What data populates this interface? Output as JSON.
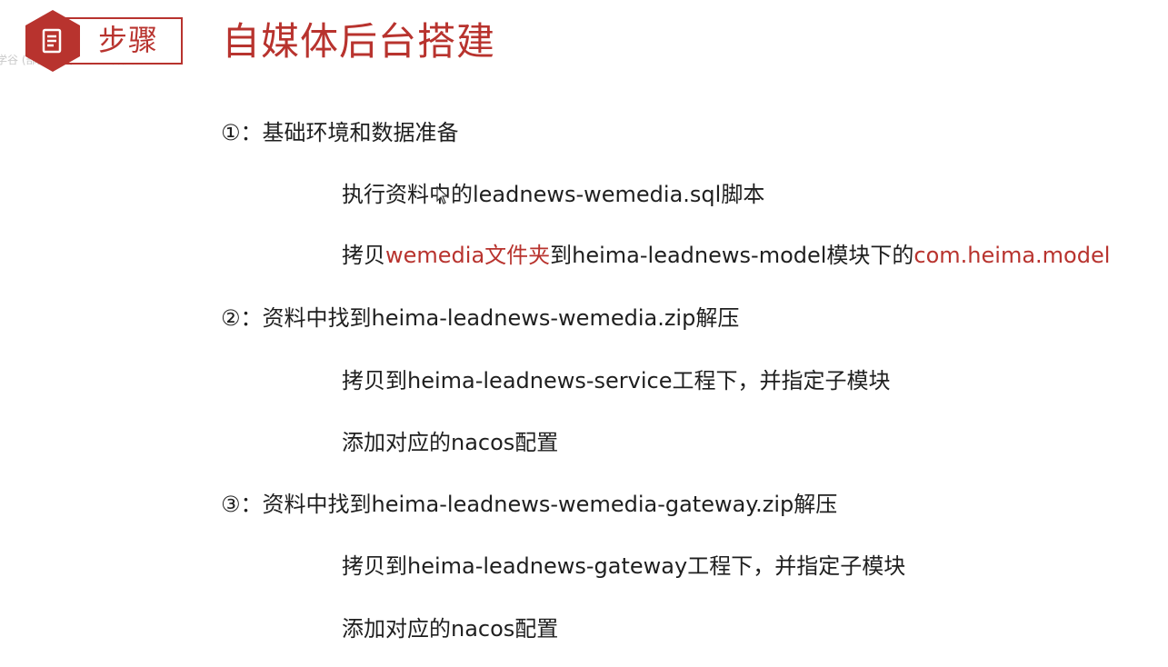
{
  "header": {
    "badge_label": "步骤",
    "badge_icon": "document-icon",
    "watermark": "学谷 (部分遮挡) 正在观看视频",
    "title": "自媒体后台搭建",
    "accent_color": "#b8332e"
  },
  "steps": [
    {
      "number": "①",
      "text": "：基础环境和数据准备",
      "items": [
        {
          "parts": [
            "执行资料中的leadnews-wemedia.sql脚本"
          ]
        },
        {
          "parts": [
            "拷贝",
            "wemedia文件夹",
            "到heima-leadnews-model模块下的",
            "com.heima.model"
          ]
        }
      ]
    },
    {
      "number": "②",
      "text": "：资料中找到heima-leadnews-wemedia.zip解压",
      "items": [
        {
          "parts": [
            "拷贝到heima-leadnews-service工程下，并指定子模块"
          ]
        },
        {
          "parts": [
            "添加对应的nacos配置"
          ]
        }
      ]
    },
    {
      "number": "③",
      "text": "：资料中找到heima-leadnews-wemedia-gateway.zip解压",
      "items": [
        {
          "parts": [
            "拷贝到heima-leadnews-gateway工程下，并指定子模块"
          ]
        },
        {
          "parts": [
            "添加对应的nacos配置"
          ]
        }
      ]
    }
  ]
}
